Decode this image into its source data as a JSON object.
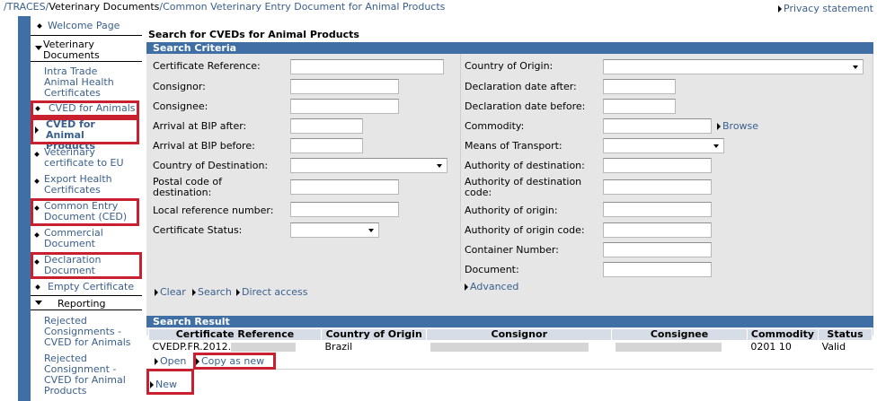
{
  "breadcrumb": {
    "leading_slash": "/",
    "traces": "TRACES",
    "sep1": "/",
    "vet_docs": "Veterinary Documents",
    "sep2": "/",
    "current": "Common Veterinary Entry Document for Animal Products"
  },
  "privacy": "Privacy statement",
  "sidebar": {
    "welcome": "Welcome Page",
    "section_vet_docs": "Veterinary Documents",
    "items": [
      "Intra Trade Animal Health Certificates",
      "CVED for Animals",
      "CVED for Animal Products",
      "Veterinary certificate to EU",
      "Export Health Certificates",
      "Common Entry Document (CED)",
      "Commercial Document",
      "Declaration Document",
      "Empty Certificate"
    ],
    "section_reporting": "Reporting",
    "reporting_items": [
      "Rejected Consignments - CVED for Animals",
      "Rejected Consignment - CVED for Animal Products"
    ]
  },
  "main": {
    "title": "Search for CVEDs for Animal Products",
    "criteria_header": "Search Criteria",
    "left_fields": {
      "cert_ref": "Certificate Reference:",
      "consignor": "Consignor:",
      "consignee": "Consignee:",
      "arrival_after": "Arrival at BIP after:",
      "arrival_before": "Arrival at BIP before:",
      "country_dest": "Country of Destination:",
      "postal_code": "Postal code of destination:",
      "local_ref": "Local reference number:",
      "cert_status": "Certificate Status:"
    },
    "right_fields": {
      "country_origin": "Country of Origin:",
      "decl_after": "Declaration date after:",
      "decl_before": "Declaration date before:",
      "commodity": "Commodity:",
      "browse": "Browse",
      "transport": "Means of Transport:",
      "auth_dest": "Authority of destination:",
      "auth_dest_code": "Authority of destination code:",
      "auth_origin": "Authority of origin:",
      "auth_origin_code": "Authority of origin code:",
      "container": "Container Number:",
      "document": "Document:"
    },
    "links": {
      "clear": "Clear",
      "search": "Search",
      "direct": "Direct access",
      "advanced": "Advanced"
    },
    "result_header": "Search Result",
    "table": {
      "headers": [
        "Certificate Reference",
        "Country of Origin",
        "Consignor",
        "Consignee",
        "Commodity",
        "Status"
      ],
      "row": {
        "cert_ref": "CVEDP.FR.2012.",
        "country": "Brazil",
        "commodity": "0201 10",
        "status": "Valid"
      }
    },
    "row_actions": {
      "open": "Open",
      "copy": "Copy as new"
    },
    "new": "New"
  },
  "colors": {
    "accent_blue": "#3f6fa5",
    "highlight_red": "#c8202f",
    "link": "#3a5f8c"
  }
}
